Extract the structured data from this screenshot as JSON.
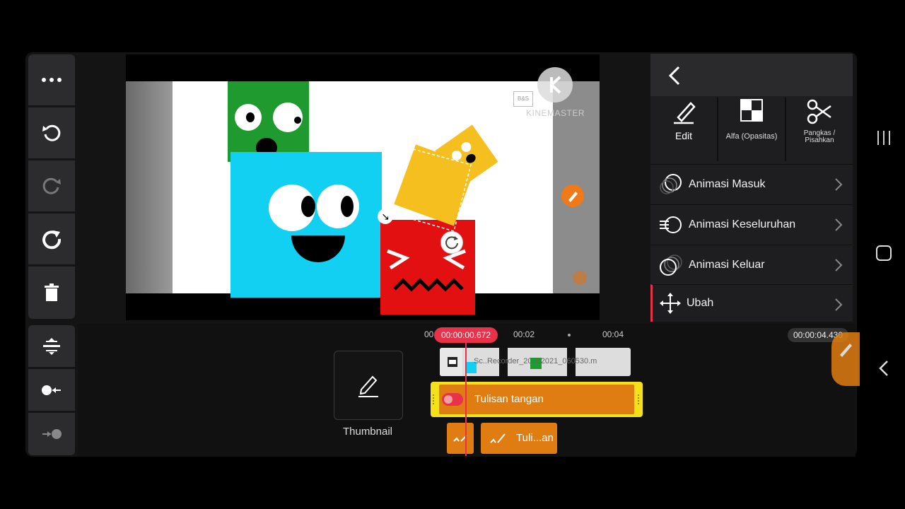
{
  "left_toolbar": {
    "items": [
      {
        "name": "more-icon"
      },
      {
        "name": "undo-icon"
      },
      {
        "name": "redo-icon"
      },
      {
        "name": "refresh-icon"
      },
      {
        "name": "trash-icon"
      },
      {
        "name": "split-align-icon"
      },
      {
        "name": "track-left-icon"
      },
      {
        "name": "track-right-icon"
      }
    ]
  },
  "preview": {
    "watermark_small": "B&S",
    "watermark": "KINEMASTER"
  },
  "right_panel": {
    "tools": [
      {
        "label": "Edit"
      },
      {
        "label": "Alfa (Opasitas)"
      },
      {
        "label": "Pangkas / Pisahkan"
      }
    ],
    "menu": [
      {
        "label": "Animasi Masuk"
      },
      {
        "label": "Animasi Keseluruhan"
      },
      {
        "label": "Animasi Keluar"
      },
      {
        "label": "Ubah"
      }
    ]
  },
  "timeline": {
    "playhead_time": "00:00:00.672",
    "ruler_start": "00",
    "ruler_2": "00:02",
    "ruler_4": "00:04",
    "total_time": "00:00:04.430",
    "video_clip_label": "Sc..Recorder_20082021_060530.m",
    "handwriting_clip_label": "Tulisan tangan",
    "small_clip_label": "Tuli...an",
    "thumbnail_label": "Thumbnail"
  },
  "colors": {
    "accent_red": "#e8324a",
    "clip_orange": "#e07d12",
    "selection_yellow": "#f5e11a",
    "panel_bg": "#1e1e20"
  }
}
